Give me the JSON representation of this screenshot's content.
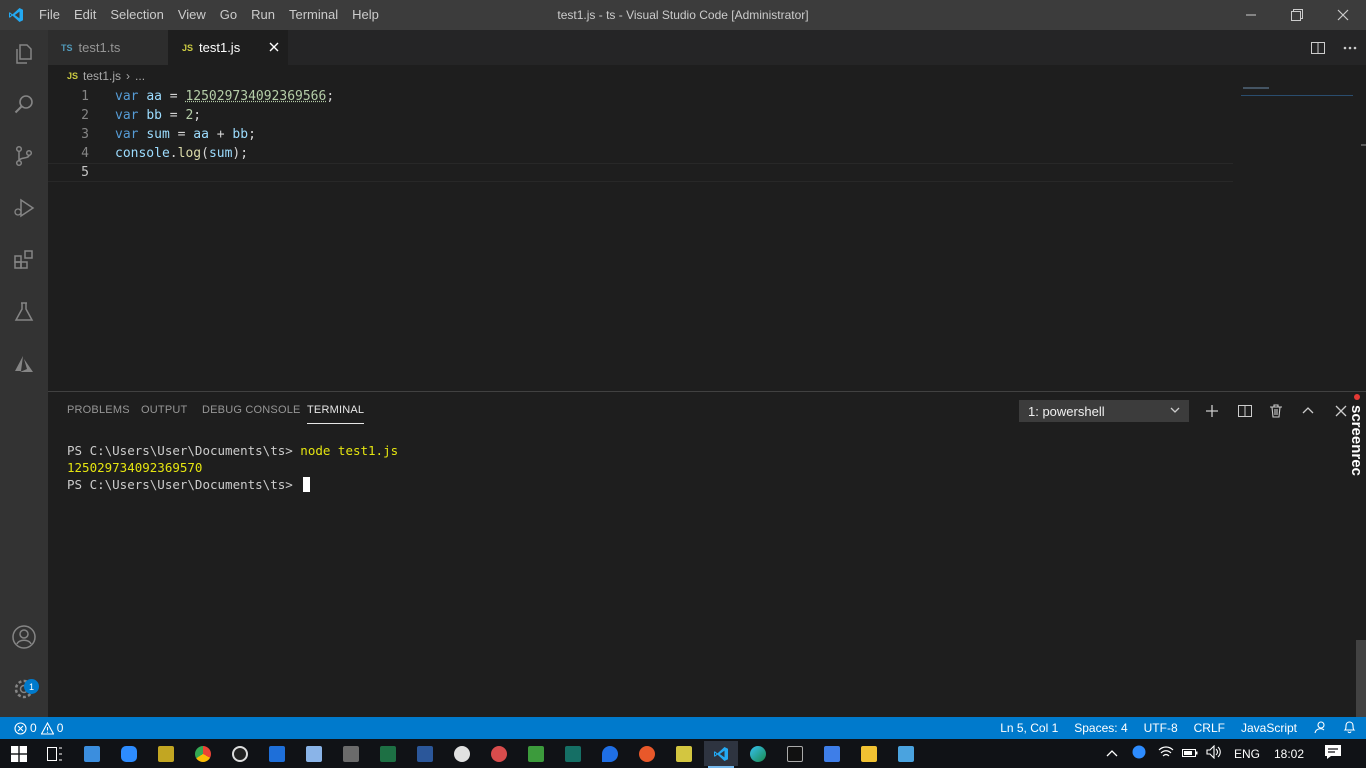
{
  "window": {
    "title": "test1.js - ts - Visual Studio Code [Administrator]",
    "menu": [
      "File",
      "Edit",
      "Selection",
      "View",
      "Go",
      "Run",
      "Terminal",
      "Help"
    ]
  },
  "activity_bar": {
    "items": [
      "explorer-icon",
      "search-icon",
      "source-control-icon",
      "run-debug-icon",
      "extensions-icon",
      "testing-icon",
      "azure-icon"
    ],
    "bottom": [
      "accounts-icon",
      "manage-gear-icon"
    ],
    "manage_badge": "1"
  },
  "tabs": [
    {
      "type": "TS",
      "label": "test1.ts",
      "active": false,
      "type_color": "#519aba"
    },
    {
      "type": "JS",
      "label": "test1.js",
      "active": true,
      "type_color": "#cbcb41"
    }
  ],
  "breadcrumb": {
    "type": "JS",
    "file": "test1.js",
    "separator": "›",
    "rest": "..."
  },
  "editor": {
    "line_numbers": [
      "1",
      "2",
      "3",
      "4",
      "5"
    ],
    "lines": [
      [
        {
          "t": "var",
          "c": "kw"
        },
        {
          "t": " "
        },
        {
          "t": "aa",
          "c": "var"
        },
        {
          "t": " = "
        },
        {
          "t": "125029734092369566",
          "c": "num"
        },
        {
          "t": ";"
        }
      ],
      [
        {
          "t": "var",
          "c": "kw"
        },
        {
          "t": " "
        },
        {
          "t": "bb",
          "c": "var"
        },
        {
          "t": " = "
        },
        {
          "t": "2",
          "c": "num"
        },
        {
          "t": ";"
        }
      ],
      [
        {
          "t": "var",
          "c": "kw"
        },
        {
          "t": " "
        },
        {
          "t": "sum",
          "c": "var"
        },
        {
          "t": " = "
        },
        {
          "t": "aa",
          "c": "var"
        },
        {
          "t": " + "
        },
        {
          "t": "bb",
          "c": "var"
        },
        {
          "t": ";"
        }
      ],
      [
        {
          "t": "console",
          "c": "var"
        },
        {
          "t": "."
        },
        {
          "t": "log",
          "c": "fn"
        },
        {
          "t": "("
        },
        {
          "t": "sum",
          "c": "var"
        },
        {
          "t": ");"
        }
      ],
      []
    ]
  },
  "panel": {
    "tabs": [
      "PROBLEMS",
      "OUTPUT",
      "DEBUG CONSOLE",
      "TERMINAL"
    ],
    "active_tab": "TERMINAL",
    "terminal_selector": "1: powershell",
    "terminal": {
      "prompt": "PS C:\\Users\\User\\Documents\\ts> ",
      "command": "node test1.js",
      "output": "125029734092369570"
    }
  },
  "status_bar": {
    "errors": "0",
    "warnings": "0",
    "position": "Ln 5, Col 1",
    "spaces": "Spaces: 4",
    "encoding": "UTF-8",
    "eol": "CRLF",
    "language": "JavaScript"
  },
  "taskbar": {
    "language": "ENG",
    "time": "18:02",
    "watermark": "screenrec"
  },
  "colors": {
    "accent": "#007acc",
    "editor_bg": "#1e1e1e",
    "title_bar": "#3c3c3c"
  }
}
